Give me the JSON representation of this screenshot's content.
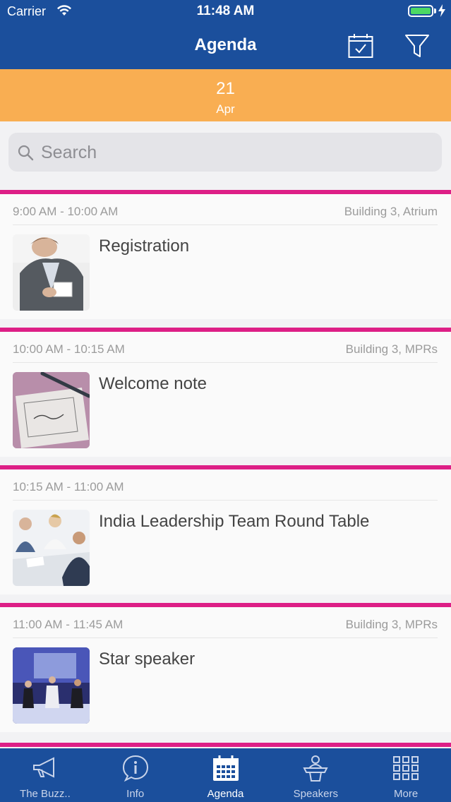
{
  "status_bar": {
    "carrier": "Carrier",
    "time": "11:48 AM"
  },
  "nav": {
    "title": "Agenda",
    "icons": [
      "calendar-check-icon",
      "filter-icon"
    ]
  },
  "date_strip": {
    "day": "21",
    "month": "Apr"
  },
  "search": {
    "placeholder": "Search"
  },
  "sessions": [
    {
      "time": "9:00 AM - 10:00 AM",
      "location": "Building 3, Atrium",
      "title": "Registration"
    },
    {
      "time": "10:00 AM - 10:15 AM",
      "location": "Building 3, MPRs",
      "title": "Welcome note"
    },
    {
      "time": "10:15 AM - 11:00 AM",
      "location": "",
      "title": "India Leadership Team Round Table"
    },
    {
      "time": "11:00 AM - 11:45 AM",
      "location": "Building 3, MPRs",
      "title": "Star speaker"
    }
  ],
  "tabs": [
    {
      "label": "The Buzz..",
      "icon": "megaphone-icon",
      "active": false
    },
    {
      "label": "Info",
      "icon": "info-icon",
      "active": false
    },
    {
      "label": "Agenda",
      "icon": "calendar-icon",
      "active": true
    },
    {
      "label": "Speakers",
      "icon": "speaker-podium-icon",
      "active": false
    },
    {
      "label": "More",
      "icon": "grid-icon",
      "active": false
    }
  ],
  "colors": {
    "primary": "#1b4f9c",
    "date_strip": "#f9ae52",
    "accent": "#dd1f86"
  }
}
